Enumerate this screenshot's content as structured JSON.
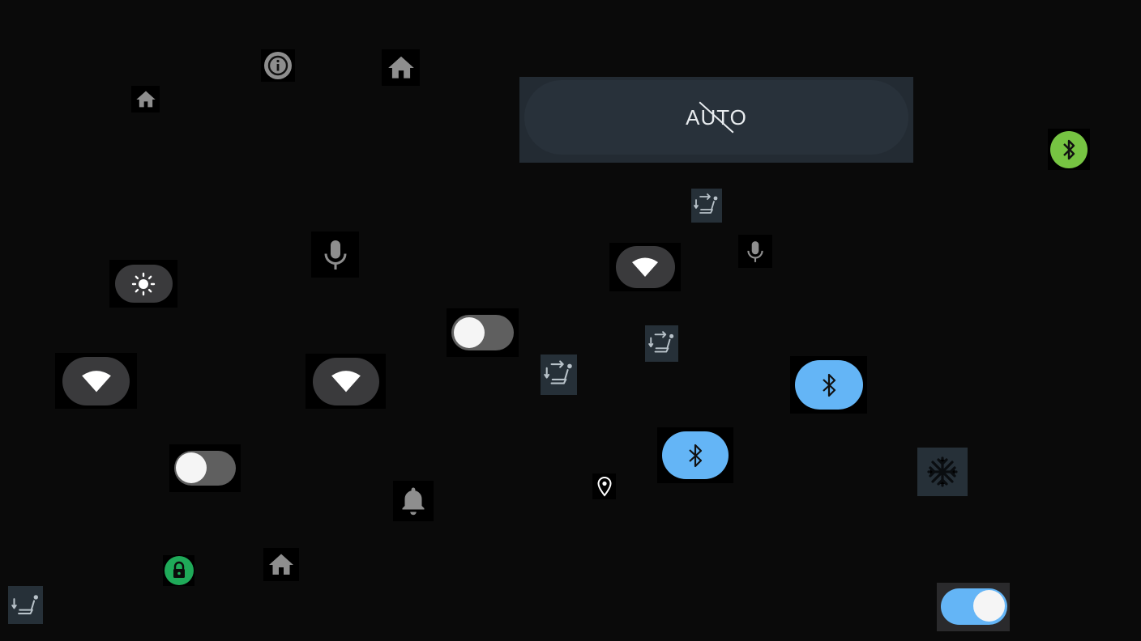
{
  "auto_button": {
    "label": "AUTO",
    "state": "off"
  },
  "icons": {
    "home": "home-icon",
    "info": "info-icon",
    "bluetooth": "bluetooth-icon",
    "seat": "seat-recline-icon",
    "microphone": "microphone-icon",
    "wifi": "wifi-icon",
    "brightness": "brightness-icon",
    "bell": "bell-icon",
    "location": "location-pin-icon",
    "snowflake": "snowflake-icon",
    "lock": "lock-icon"
  },
  "toggles": [
    {
      "id": "toggle-1",
      "on": false
    },
    {
      "id": "toggle-2",
      "on": false
    },
    {
      "id": "toggle-3",
      "on": true
    }
  ],
  "colors": {
    "background": "#0a0a0a",
    "accent_blue": "#64b5f6",
    "bluetooth_green": "#76c442",
    "lock_green": "#1faa59",
    "pill_gray": "#3a3a3c",
    "panel": "#232b33",
    "seat_tile": "#263038"
  }
}
